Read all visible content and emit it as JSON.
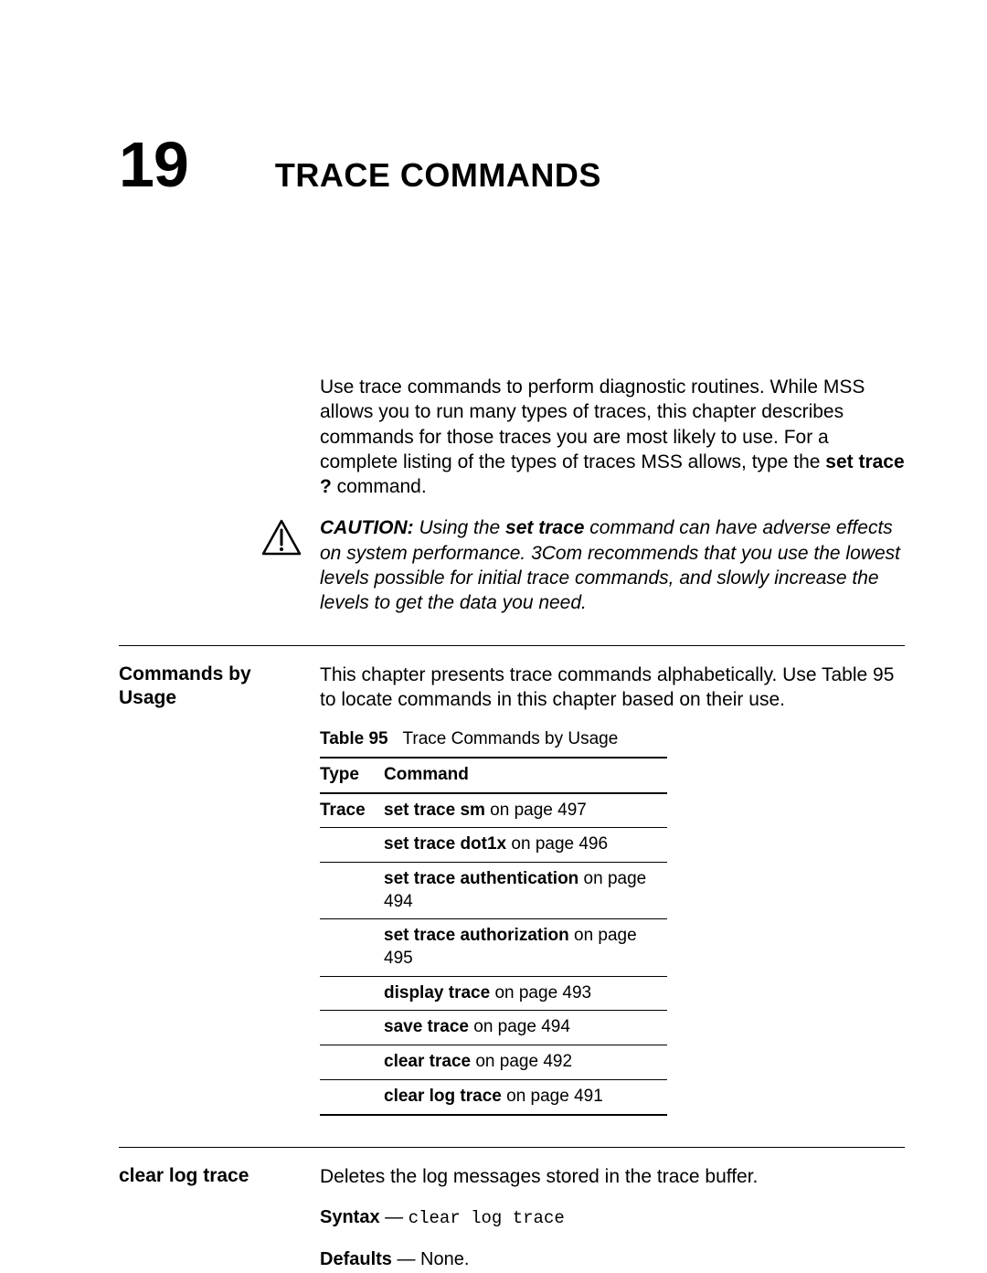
{
  "chapter": {
    "number": "19",
    "title": "TRACE COMMANDS"
  },
  "intro": {
    "p1_a": "Use trace commands to perform diagnostic routines. While MSS allows you to run many types of traces, this chapter describes commands for those traces you are most likely to use. For a complete listing of the types of traces MSS allows, type the ",
    "p1_bold": "set trace ?",
    "p1_b": " command."
  },
  "caution": {
    "lead": "CAUTION:",
    "t1": " Using the ",
    "cmd": "set trace",
    "t2": " command can have adverse effects on system performance. 3Com recommends that you use the lowest levels possible for initial trace commands, and slowly increase the levels to get the data you need."
  },
  "sections": {
    "commands_by_usage": {
      "heading": "Commands by Usage",
      "body": "This chapter presents trace commands alphabetically. Use Table 95 to locate commands in this chapter based on their use.",
      "table_label": "Table 95",
      "table_title": "Trace Commands by Usage",
      "col_type": "Type",
      "col_command": "Command",
      "rows": [
        {
          "type": "Trace",
          "cmd_bold": "set trace sm",
          "tail": " on page 497"
        },
        {
          "type": "",
          "cmd_bold": "set trace dot1x",
          "tail": " on page 496"
        },
        {
          "type": "",
          "cmd_bold": "set trace authentication",
          "tail": " on page 494"
        },
        {
          "type": "",
          "cmd_bold": "set trace authorization",
          "tail": " on page 495"
        },
        {
          "type": "",
          "cmd_bold": "display trace",
          "tail": " on page 493"
        },
        {
          "type": "",
          "cmd_bold": "save trace",
          "tail": " on page 494"
        },
        {
          "type": "",
          "cmd_bold": "clear trace",
          "tail": " on page 492"
        },
        {
          "type": "",
          "cmd_bold": "clear log trace",
          "tail": " on page 491"
        }
      ]
    },
    "clear_log_trace": {
      "heading": "clear log trace",
      "body": "Deletes the log messages stored in the trace buffer.",
      "syntax_label": "Syntax",
      "syntax_sep": " — ",
      "syntax_cmd": "clear log trace",
      "defaults_label": "Defaults",
      "defaults_sep": " — ",
      "defaults_val": "None."
    }
  }
}
